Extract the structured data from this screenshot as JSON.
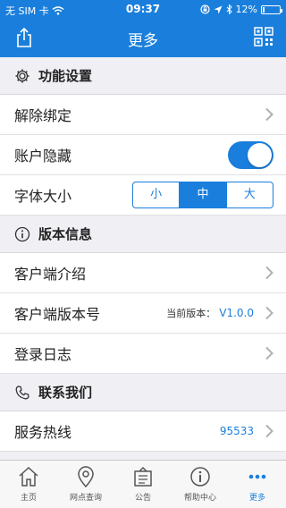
{
  "status_bar": {
    "carrier": "无 SIM 卡",
    "time": "09:37",
    "battery": "12%",
    "battery_level": 0.12
  },
  "nav": {
    "title": "更多"
  },
  "sections": {
    "settings": {
      "title": "功能设置",
      "unbind_label": "解除绑定",
      "hide_account_label": "账户隐藏",
      "hide_account_on": true,
      "font_size_label": "字体大小",
      "font_options": [
        "小",
        "中",
        "大"
      ],
      "font_selected": "中"
    },
    "version": {
      "title": "版本信息",
      "intro_label": "客户端介绍",
      "version_label": "客户端版本号",
      "current_prefix": "当前版本：",
      "current_value": "V1.0.0",
      "log_label": "登录日志"
    },
    "contact": {
      "title": "联系我们",
      "hotline_label": "服务热线",
      "hotline_value": "95533"
    }
  },
  "tabs": [
    {
      "label": "主页",
      "icon": "home-icon"
    },
    {
      "label": "网点查询",
      "icon": "location-pin-icon"
    },
    {
      "label": "公告",
      "icon": "notice-icon"
    },
    {
      "label": "帮助中心",
      "icon": "info-icon"
    },
    {
      "label": "更多",
      "icon": "more-icon"
    }
  ],
  "colors": {
    "accent": "#1a7fdc",
    "section_bg": "#efeff4"
  }
}
